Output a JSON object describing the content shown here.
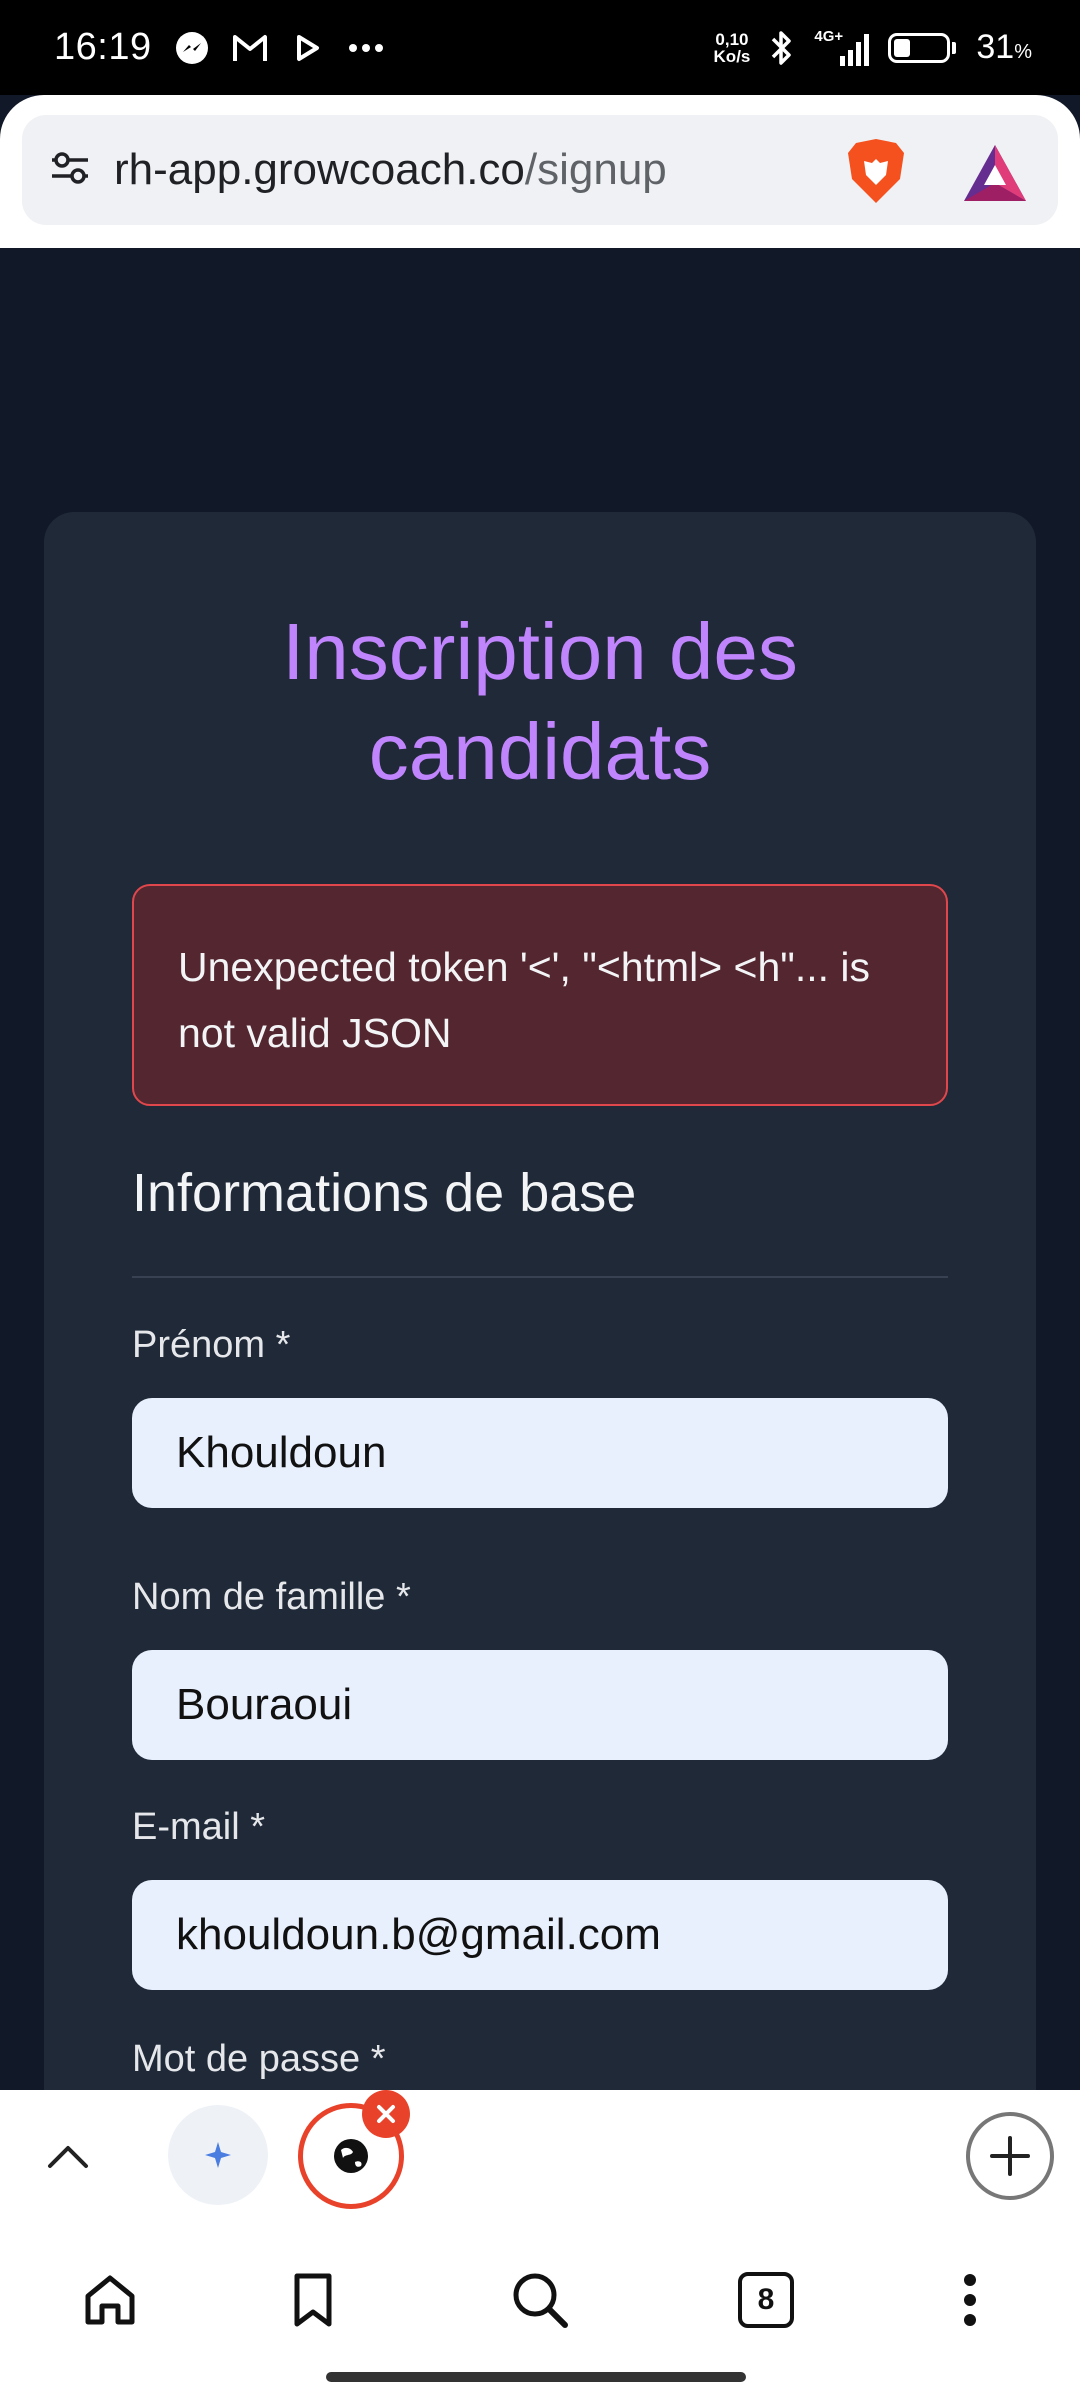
{
  "status_bar": {
    "time": "16:19",
    "net_speed_value": "0,10",
    "net_speed_unit": "Ko/s",
    "network_type": "4G+",
    "battery_percent": "31",
    "battery_unit": "%",
    "battery_level": 0.31,
    "notification_icons": [
      "messenger-icon",
      "gmail-icon",
      "play-icon",
      "more-dots-icon"
    ]
  },
  "browser": {
    "url_domain": "rh-app.growcoach.co",
    "url_path": "/signup",
    "tab_count": "8"
  },
  "form": {
    "title": "Inscription des candidats",
    "error_message": "Unexpected token '<', \"<html> <h\"... is not valid JSON",
    "section_title": "Informations de base",
    "fields": [
      {
        "label": "Prénom *",
        "value": "Khouldoun"
      },
      {
        "label": "Nom de famille *",
        "value": "Bouraoui"
      },
      {
        "label": "E-mail *",
        "value": "khouldoun.b@gmail.com"
      },
      {
        "label": "Mot de passe *",
        "value": ""
      }
    ]
  },
  "colors": {
    "page_bg": "#111827",
    "card_bg": "#1f2937",
    "title_accent": "#c084fc",
    "error_bg": "#532630",
    "error_border": "#e0474c",
    "input_bg": "#e8f0fe",
    "active_tab_ring": "#e8432a"
  }
}
